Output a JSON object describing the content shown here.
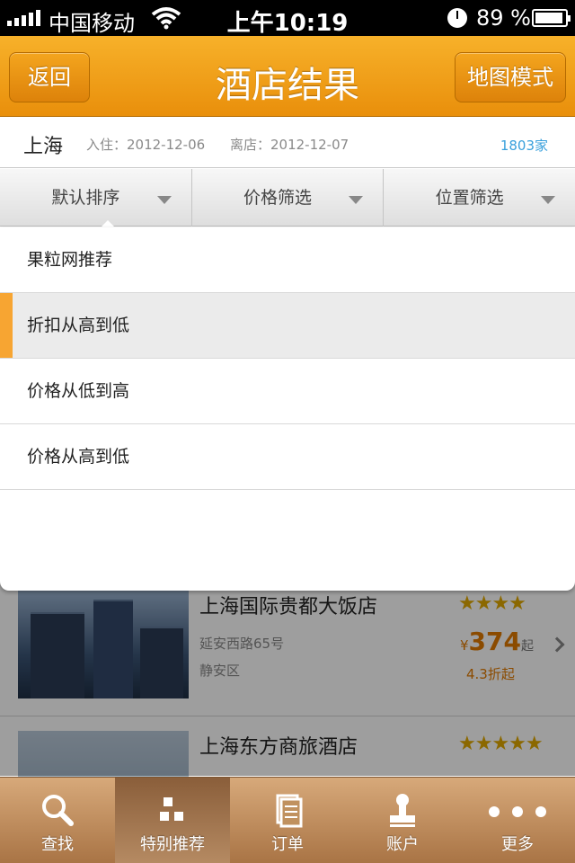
{
  "status_bar": {
    "carrier": "中国移动",
    "time": "上午10:19",
    "battery": "89 %"
  },
  "header": {
    "title": "酒店结果",
    "back_label": "返回",
    "map_label": "地图模式"
  },
  "info": {
    "city": "上海",
    "checkin": "入住：2012-12-06",
    "checkout": "离店：2012-12-07",
    "count": "1803家"
  },
  "filters": [
    {
      "label": "默认排序"
    },
    {
      "label": "价格筛选"
    },
    {
      "label": "位置筛选"
    }
  ],
  "sort_options": [
    {
      "label": "果粒网推荐"
    },
    {
      "label": "折扣从高到低",
      "selected": true
    },
    {
      "label": "价格从低到高"
    },
    {
      "label": "价格从高到低"
    }
  ],
  "hotels": [
    {
      "name": "上海国际贵都大饭店",
      "address": "延安西路65号",
      "district": "静安区",
      "stars": "★★★★",
      "currency": "¥",
      "price": "374",
      "price_suffix": "起",
      "discount": "4.3折起"
    },
    {
      "name": "上海东方商旅酒店",
      "stars": "★★★★★"
    }
  ],
  "tabs": [
    {
      "label": "查找",
      "icon": "search-icon"
    },
    {
      "label": "特别推荐",
      "icon": "grid-icon",
      "active": true
    },
    {
      "label": "订单",
      "icon": "document-icon"
    },
    {
      "label": "账户",
      "icon": "user-icon"
    },
    {
      "label": "更多",
      "icon": "more-icon"
    }
  ]
}
